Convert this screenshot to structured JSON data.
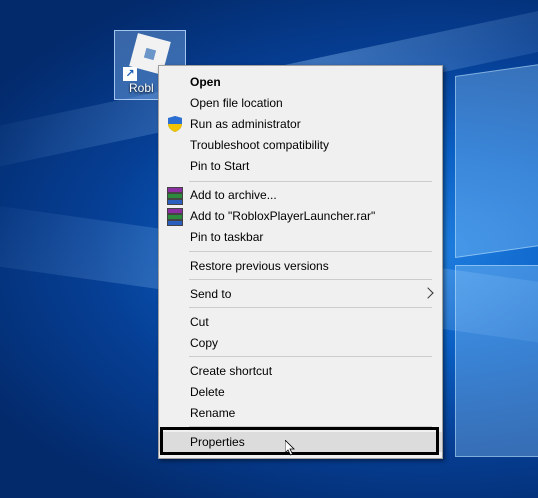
{
  "desktop": {
    "icon_label": "Robl",
    "icon_name": "roblox-logo-icon"
  },
  "menu": {
    "items": [
      {
        "label": "Open",
        "bold": true
      },
      {
        "label": "Open file location"
      },
      {
        "label": "Run as administrator",
        "icon": "uac-shield-icon"
      },
      {
        "label": "Troubleshoot compatibility"
      },
      {
        "label": "Pin to Start"
      },
      {
        "label": "Add to archive...",
        "icon": "winrar-icon"
      },
      {
        "label": "Add to \"RobloxPlayerLauncher.rar\"",
        "icon": "winrar-icon"
      },
      {
        "label": "Pin to taskbar"
      },
      {
        "label": "Restore previous versions"
      },
      {
        "label": "Send to",
        "submenu": true
      },
      {
        "label": "Cut"
      },
      {
        "label": "Copy"
      },
      {
        "label": "Create shortcut"
      },
      {
        "label": "Delete"
      },
      {
        "label": "Rename"
      },
      {
        "label": "Properties",
        "highlighted": true
      }
    ]
  },
  "colors": {
    "menu_bg": "#f0f0f0",
    "highlight_bg": "#dcdcdc",
    "desktop_blue": "#0a5fc4"
  }
}
